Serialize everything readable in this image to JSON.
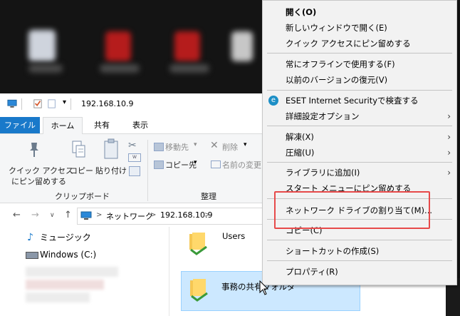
{
  "window": {
    "address_title": "192.168.10.9"
  },
  "tabs": [
    {
      "label": "ファイル"
    },
    {
      "label": "ホーム"
    },
    {
      "label": "共有"
    },
    {
      "label": "表示"
    }
  ],
  "ribbon": {
    "pin_quick_access": "クイック アクセス",
    "pin_quick_access2": "にピン留めする",
    "copy": "コピー",
    "paste": "貼り付け",
    "clipboard_group": "クリップボード",
    "move_to": "移動先",
    "delete": "削除",
    "copy_to": "コピー先",
    "rename": "名前の変更",
    "organize_group": "整理"
  },
  "address": {
    "segments": [
      "ネットワーク",
      "192.168.10.9"
    ],
    "sep": ">"
  },
  "nav_pane": [
    {
      "label": "ミュージック"
    },
    {
      "label": "Windows (C:)"
    }
  ],
  "items": [
    {
      "label": "Users"
    },
    {
      "label": "事務の共有フォルダ"
    }
  ],
  "context_menu": {
    "items": [
      {
        "label": "開く(O)"
      },
      {
        "label": "新しいウィンドウで開く(E)"
      },
      {
        "label": "クイック アクセスにピン留めする"
      },
      {
        "label": "常にオフラインで使用する(F)"
      },
      {
        "label": "以前のバージョンの復元(V)"
      },
      {
        "label": "ESET Internet Securityで検査する"
      },
      {
        "label": "詳細設定オプション"
      },
      {
        "label": "解凍(X)"
      },
      {
        "label": "圧縮(U)"
      },
      {
        "label": "ライブラリに追加(I)"
      },
      {
        "label": "スタート メニューにピン留めする"
      },
      {
        "label": "ネットワーク ドライブの割り当て(M)..."
      },
      {
        "label": "コピー(C)"
      },
      {
        "label": "ショートカットの作成(S)"
      },
      {
        "label": "プロパティ(R)"
      }
    ]
  },
  "colors": {
    "file_tab": "#1979ca",
    "highlight": "#e74a4a",
    "selected_item": "#cce8ff",
    "eset_icon": "#1d8fc6"
  }
}
